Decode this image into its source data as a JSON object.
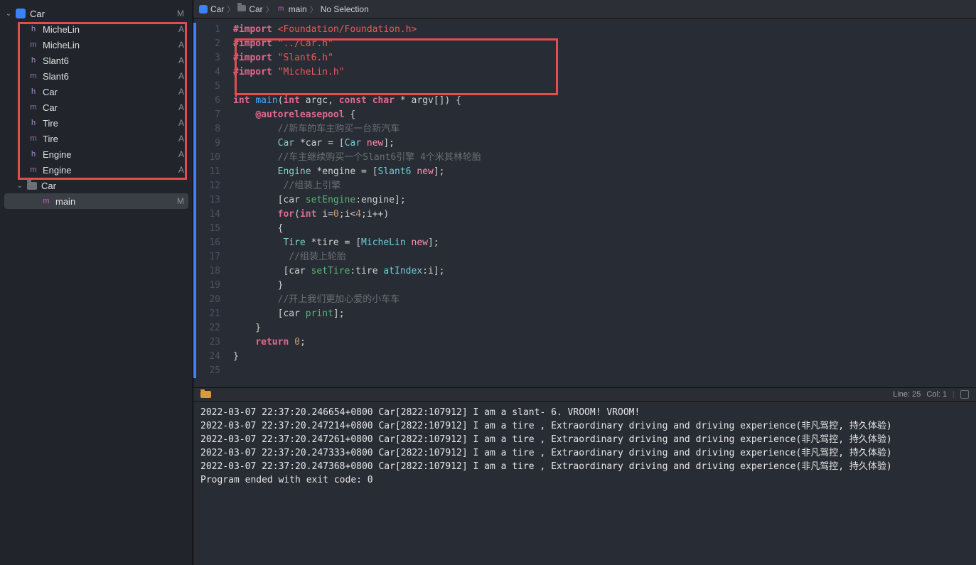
{
  "sidebar": {
    "root": {
      "label": "Car",
      "scm": "M"
    },
    "items": [
      {
        "icon": "h",
        "label": "MicheLin",
        "scm": "A"
      },
      {
        "icon": "m",
        "label": "MicheLin",
        "scm": "A"
      },
      {
        "icon": "h",
        "label": "Slant6",
        "scm": "A"
      },
      {
        "icon": "m",
        "label": "Slant6",
        "scm": "A"
      },
      {
        "icon": "h",
        "label": "Car",
        "scm": "A"
      },
      {
        "icon": "m",
        "label": "Car",
        "scm": "A"
      },
      {
        "icon": "h",
        "label": "Tire",
        "scm": "A"
      },
      {
        "icon": "m",
        "label": "Tire",
        "scm": "A"
      },
      {
        "icon": "h",
        "label": "Engine",
        "scm": "A"
      },
      {
        "icon": "m",
        "label": "Engine",
        "scm": "A"
      }
    ],
    "folder": {
      "label": "Car"
    },
    "selected": {
      "icon": "m",
      "label": "main",
      "scm": "M"
    }
  },
  "breadcrumb": {
    "items": [
      "Car",
      "Car",
      "main",
      "No Selection"
    ]
  },
  "code": {
    "lines": [
      [
        [
          "kw",
          "#import "
        ],
        [
          "inc",
          "<Foundation/Foundation.h>"
        ]
      ],
      [
        [
          "kw",
          "#import "
        ],
        [
          "str",
          "\"../Car.h\""
        ]
      ],
      [
        [
          "kw",
          "#import "
        ],
        [
          "str",
          "\"Slant6.h\""
        ]
      ],
      [
        [
          "kw",
          "#import "
        ],
        [
          "str",
          "\"MicheLin.h\""
        ]
      ],
      [],
      [
        [
          "kw",
          "int "
        ],
        [
          "fn",
          "main"
        ],
        [
          "p",
          "("
        ],
        [
          "kw",
          "int "
        ],
        [
          "var",
          "argc"
        ],
        [
          "p",
          ", "
        ],
        [
          "kw",
          "const char"
        ],
        [
          "p",
          " * "
        ],
        [
          "var",
          "argv"
        ],
        [
          "p",
          "[]) {"
        ]
      ],
      [
        [
          "p",
          "    "
        ],
        [
          "at",
          "@autoreleasepool "
        ],
        [
          "p",
          "{"
        ]
      ],
      [
        [
          "p",
          "        "
        ],
        [
          "com",
          "//新车的车主购买一台新汽车"
        ]
      ],
      [
        [
          "p",
          "        "
        ],
        [
          "type",
          "Car "
        ],
        [
          "p",
          "*"
        ],
        [
          "var",
          "car"
        ],
        [
          "p",
          " = ["
        ],
        [
          "class",
          "Car "
        ],
        [
          "self",
          "new"
        ],
        [
          "p",
          "];"
        ]
      ],
      [
        [
          "p",
          "        "
        ],
        [
          "com",
          "//车主继续购买一个Slant6引擎 4个米其林轮胎"
        ]
      ],
      [
        [
          "p",
          "        "
        ],
        [
          "type",
          "Engine "
        ],
        [
          "p",
          "*"
        ],
        [
          "var",
          "engine"
        ],
        [
          "p",
          " = ["
        ],
        [
          "class",
          "Slant6 "
        ],
        [
          "self",
          "new"
        ],
        [
          "p",
          "];"
        ]
      ],
      [
        [
          "p",
          "         "
        ],
        [
          "com",
          "//组装上引擎"
        ]
      ],
      [
        [
          "p",
          "        ["
        ],
        [
          "var",
          "car "
        ],
        [
          "method",
          "setEngine"
        ],
        [
          "p",
          ":"
        ],
        [
          "var",
          "engine"
        ],
        [
          "p",
          "];"
        ]
      ],
      [
        [
          "p",
          "        "
        ],
        [
          "kw",
          "for"
        ],
        [
          "p",
          "("
        ],
        [
          "kw",
          "int "
        ],
        [
          "var",
          "i"
        ],
        [
          "p",
          "="
        ],
        [
          "num",
          "0"
        ],
        [
          "p",
          ";"
        ],
        [
          "var",
          "i"
        ],
        [
          "p",
          "<"
        ],
        [
          "num",
          "4"
        ],
        [
          "p",
          ";"
        ],
        [
          "var",
          "i"
        ],
        [
          "p",
          "++)"
        ]
      ],
      [
        [
          "p",
          "        {"
        ]
      ],
      [
        [
          "p",
          "         "
        ],
        [
          "type",
          "Tire "
        ],
        [
          "p",
          "*"
        ],
        [
          "var",
          "tire"
        ],
        [
          "p",
          " = ["
        ],
        [
          "class",
          "MicheLin "
        ],
        [
          "self",
          "new"
        ],
        [
          "p",
          "];"
        ]
      ],
      [
        [
          "p",
          "          "
        ],
        [
          "com",
          "//组装上轮胎"
        ]
      ],
      [
        [
          "p",
          "         ["
        ],
        [
          "var",
          "car "
        ],
        [
          "method",
          "setTire"
        ],
        [
          "p",
          ":"
        ],
        [
          "var",
          "tire "
        ],
        [
          "param",
          "atIndex"
        ],
        [
          "p",
          ":"
        ],
        [
          "var",
          "i"
        ],
        [
          "p",
          "];"
        ]
      ],
      [
        [
          "p",
          "        }"
        ]
      ],
      [
        [
          "p",
          "        "
        ],
        [
          "com",
          "//开上我们更加心爱的小车车"
        ]
      ],
      [
        [
          "p",
          "        ["
        ],
        [
          "var",
          "car "
        ],
        [
          "method",
          "print"
        ],
        [
          "p",
          "];"
        ]
      ],
      [
        [
          "p",
          "    }"
        ]
      ],
      [
        [
          "p",
          "    "
        ],
        [
          "kw",
          "return "
        ],
        [
          "num",
          "0"
        ],
        [
          "p",
          ";"
        ]
      ],
      [
        [
          "p",
          "}"
        ]
      ],
      []
    ]
  },
  "status": {
    "line": "Line: 25",
    "col": "Col: 1"
  },
  "console": [
    "2022-03-07 22:37:20.246654+0800 Car[2822:107912] I am a slant- 6. VROOM! VROOM!",
    "2022-03-07 22:37:20.247214+0800 Car[2822:107912] I am a tire , Extraordinary driving and driving experience(非凡驾控, 持久体验)",
    "2022-03-07 22:37:20.247261+0800 Car[2822:107912] I am a tire , Extraordinary driving and driving experience(非凡驾控, 持久体验)",
    "2022-03-07 22:37:20.247333+0800 Car[2822:107912] I am a tire , Extraordinary driving and driving experience(非凡驾控, 持久体验)",
    "2022-03-07 22:37:20.247368+0800 Car[2822:107912] I am a tire , Extraordinary driving and driving experience(非凡驾控, 持久体验)",
    "Program ended with exit code: 0"
  ]
}
